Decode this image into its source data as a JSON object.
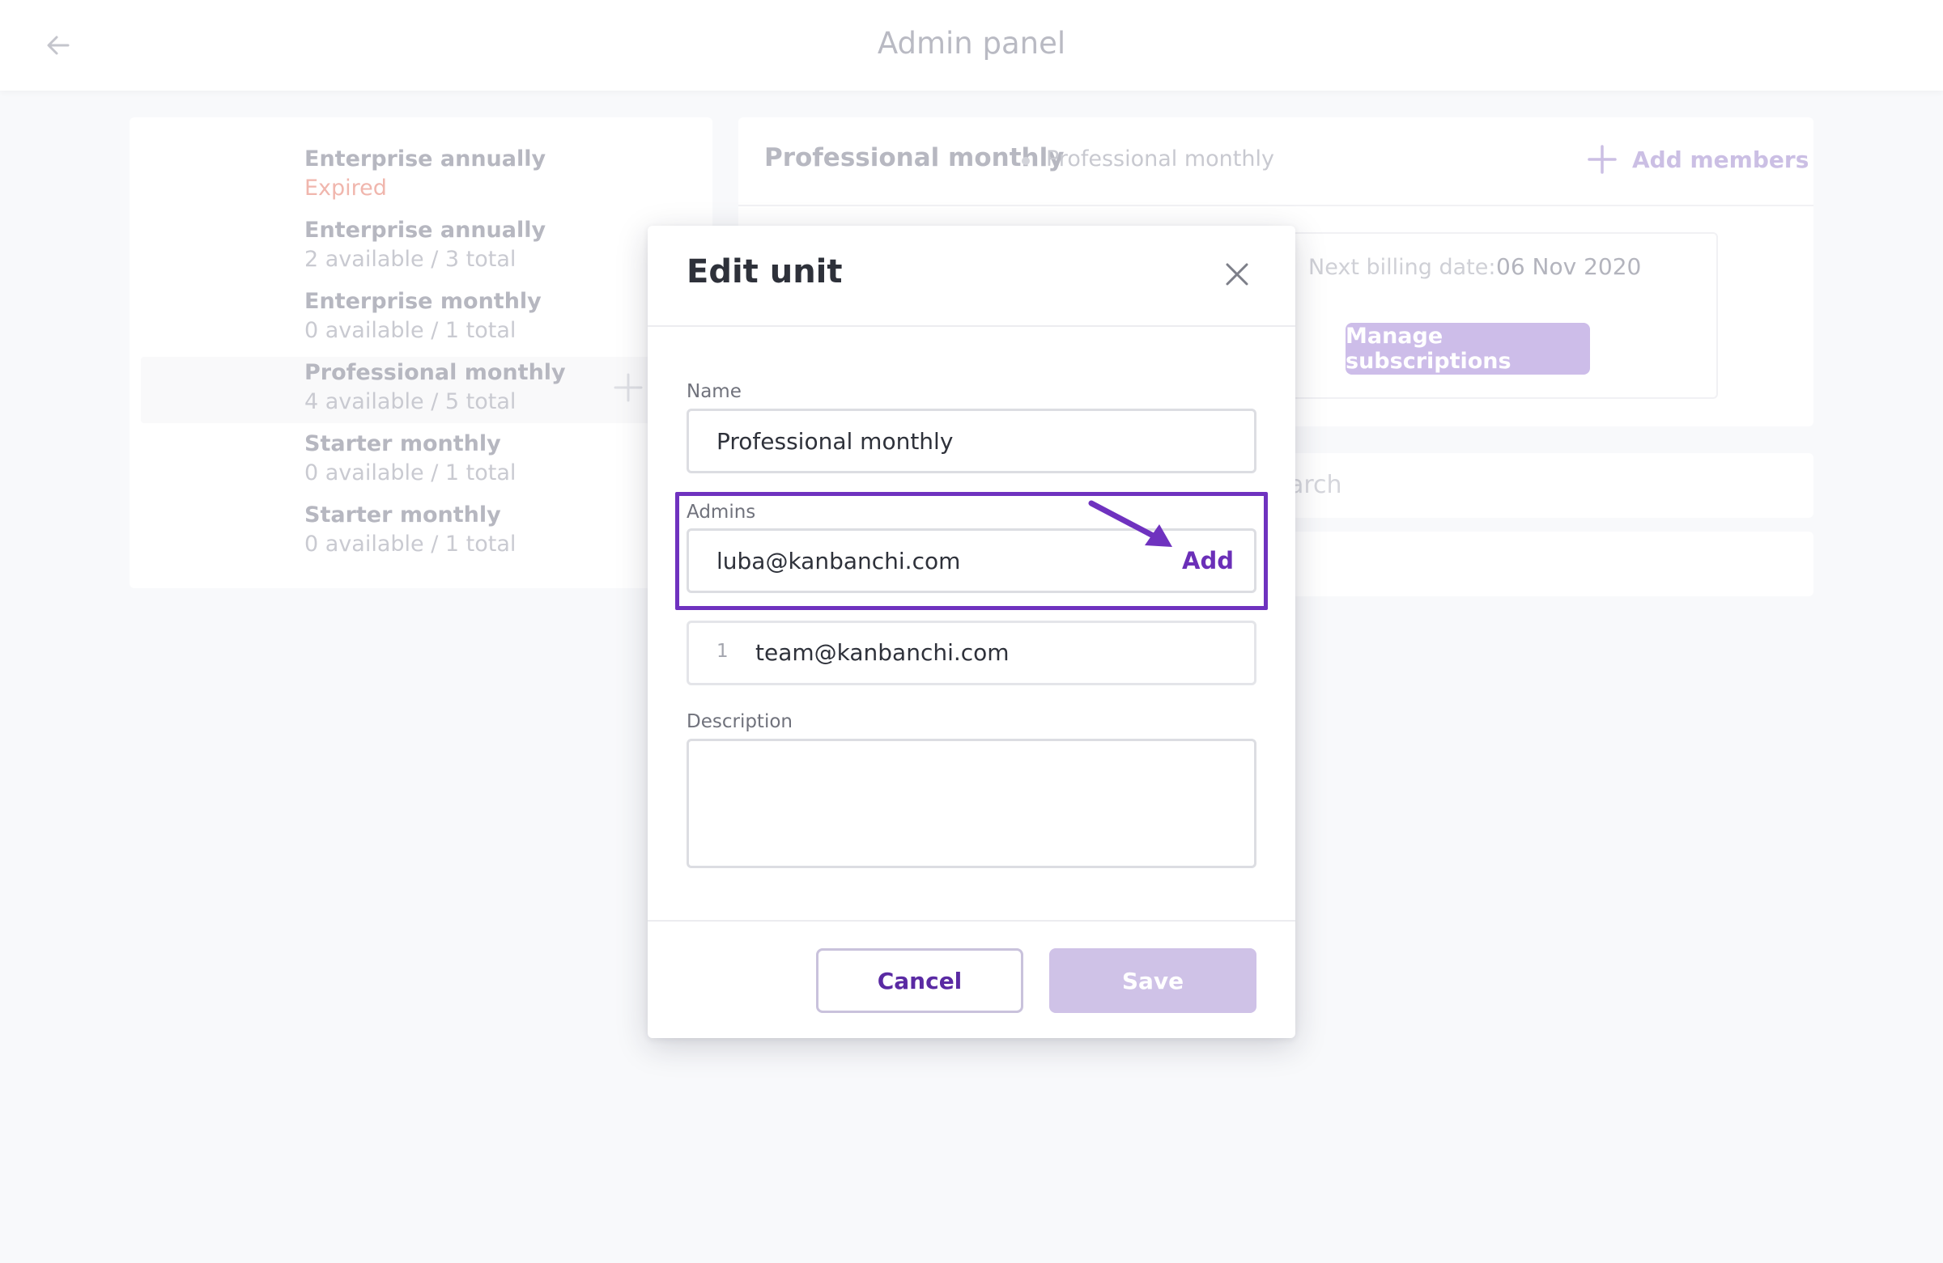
{
  "header": {
    "title": "Admin panel",
    "back_icon": "arrow-left-icon"
  },
  "subscriptions": [
    {
      "title": "Enterprise annually",
      "status": "Expired",
      "status_type": "expired"
    },
    {
      "title": "Enterprise annually",
      "status": "2 available / 3 total",
      "status_type": "normal"
    },
    {
      "title": "Enterprise monthly",
      "status": "0 available / 1 total",
      "status_type": "normal"
    },
    {
      "title": "Professional monthly",
      "status": "4 available / 5 total",
      "status_type": "normal",
      "selected": true
    },
    {
      "title": "Starter monthly",
      "status": "0 available / 1 total",
      "status_type": "normal"
    },
    {
      "title": "Starter monthly",
      "status": "0 available / 1 total",
      "status_type": "normal"
    }
  ],
  "unit_panel": {
    "title": "Professional monthly",
    "subtitle": "Professional monthly",
    "add_members_label": "Add members",
    "billing_label": "Next billing date:",
    "billing_value": "06 Nov 2020",
    "manage_button": "Manage subscriptions",
    "search_partial": "arch"
  },
  "modal": {
    "title": "Edit unit",
    "name_label": "Name",
    "name_value": "Professional monthly",
    "admins_label": "Admins",
    "admins_input_value": "luba@kanbanchi.com",
    "add_button": "Add",
    "admins": [
      {
        "index": "1",
        "email": "team@kanbanchi.com"
      }
    ],
    "description_label": "Description",
    "description_value": "",
    "cancel_button": "Cancel",
    "save_button": "Save"
  },
  "colors": {
    "accent": "#6b2fb8",
    "highlight": "#6f32bf",
    "expired": "#f0b6ad",
    "save_disabled": "#cfc2e7"
  }
}
